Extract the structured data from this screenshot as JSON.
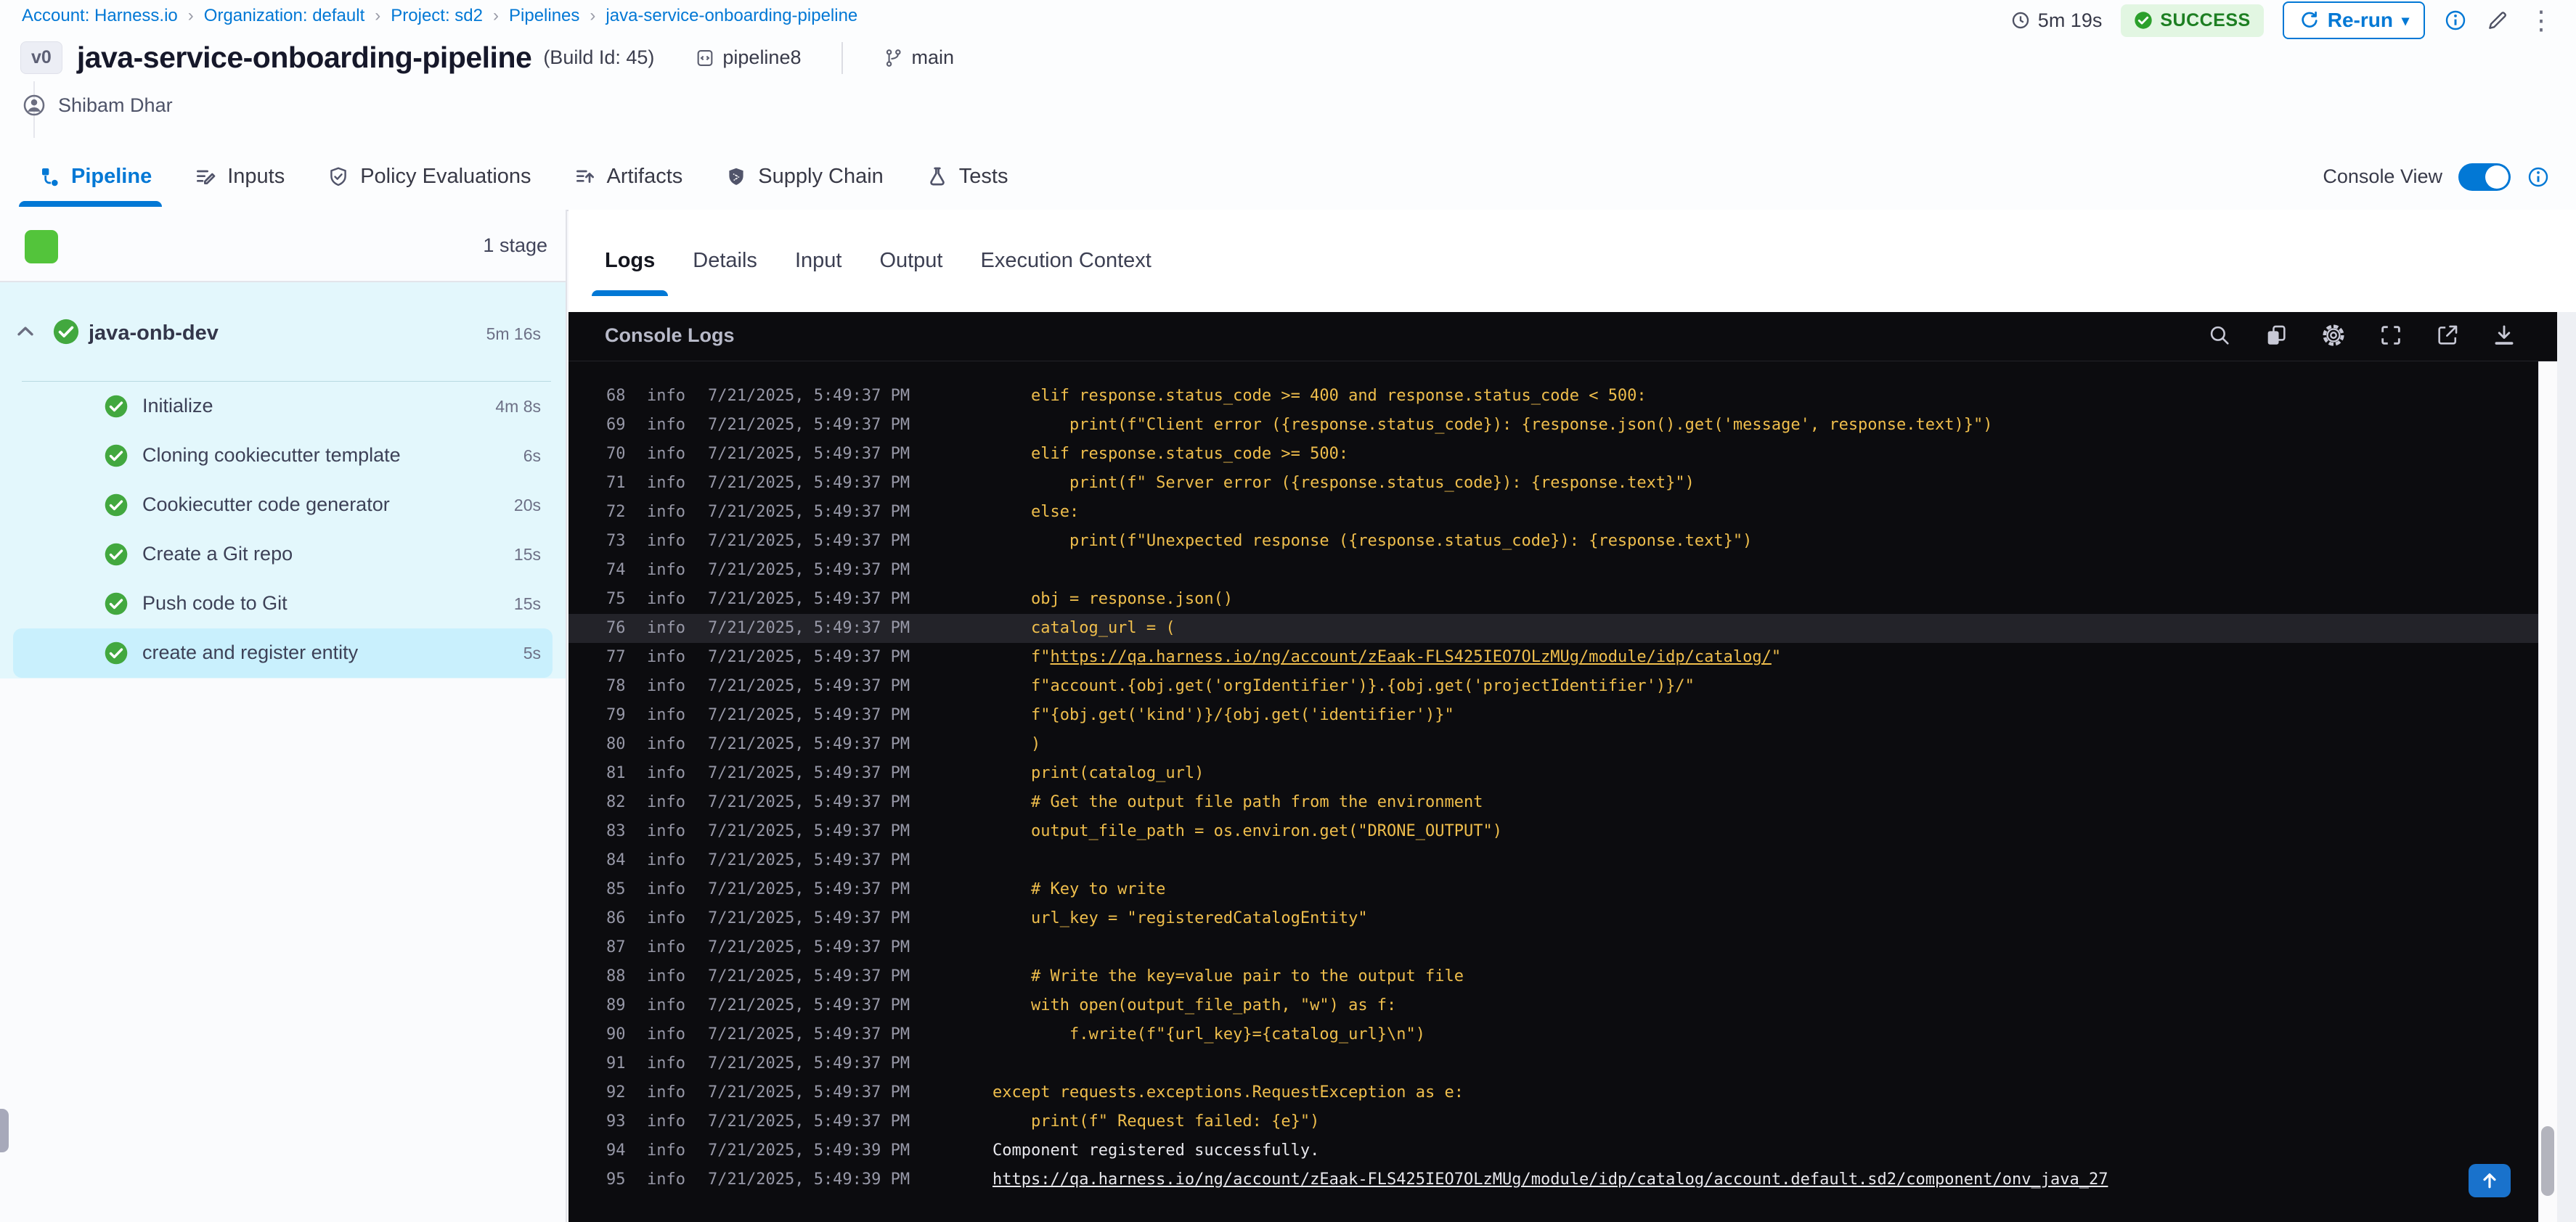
{
  "colors": {
    "accent": "#0278D5",
    "success_text": "#1D7F22",
    "success_badge_bg": "#E2F6E2",
    "check_green": "#42A83F",
    "stage_square_green": "#53C43B",
    "sidebar_bg": "#E3F7FC",
    "step_selected_bg": "#C9F0FD",
    "console_bg": "#0C0C0F",
    "log_yellow": "#EFBE4C",
    "log_white": "#E8E8ED",
    "log_meta_gray": "#9798A7"
  },
  "breadcrumb": {
    "items": [
      "Account: Harness.io",
      "Organization: default",
      "Project: sd2",
      "Pipelines",
      "java-service-onboarding-pipeline"
    ]
  },
  "header": {
    "version_tag": "v0",
    "title": "java-service-onboarding-pipeline",
    "build_id": "(Build Id: 45)",
    "pipeline_ref": "pipeline8",
    "branch": "main",
    "user": "Shibam Dhar",
    "duration": "5m 19s",
    "status": "SUCCESS",
    "rerun_label": "Re-run",
    "rerun_caret": "▾",
    "kebab": "⋮"
  },
  "tabbar": {
    "tabs": [
      {
        "label": "Pipeline",
        "icon": "pipeline",
        "active": true
      },
      {
        "label": "Inputs",
        "icon": "inputs",
        "active": false
      },
      {
        "label": "Policy Evaluations",
        "icon": "policy",
        "active": false
      },
      {
        "label": "Artifacts",
        "icon": "artifacts",
        "active": false
      },
      {
        "label": "Supply Chain",
        "icon": "supplychain",
        "active": false
      },
      {
        "label": "Tests",
        "icon": "tests",
        "active": false
      }
    ],
    "console_view_label": "Console View"
  },
  "sidebar": {
    "stage_count": "1 stage",
    "stage": {
      "name": "java-onb-dev",
      "duration": "5m 16s"
    },
    "steps": [
      {
        "label": "Initialize",
        "duration": "4m 8s",
        "selected": false
      },
      {
        "label": "Cloning cookiecutter template",
        "duration": "6s",
        "selected": false
      },
      {
        "label": "Cookiecutter code generator",
        "duration": "20s",
        "selected": false
      },
      {
        "label": "Create a Git repo",
        "duration": "15s",
        "selected": false
      },
      {
        "label": "Push code to Git",
        "duration": "15s",
        "selected": false
      },
      {
        "label": "create and register entity",
        "duration": "5s",
        "selected": true
      }
    ]
  },
  "main": {
    "log_tabs": [
      "Logs",
      "Details",
      "Input",
      "Output",
      "Execution Context"
    ]
  },
  "console": {
    "title": "Console Logs",
    "lines": [
      {
        "n": "68",
        "lvl": "info",
        "ts": "7/21/2025, 5:49:37 PM",
        "c": "y",
        "text": "    elif response.status_code >= 400 and response.status_code < 500:"
      },
      {
        "n": "69",
        "lvl": "info",
        "ts": "7/21/2025, 5:49:37 PM",
        "c": "y",
        "text": "        print(f\"Client error ({response.status_code}): {response.json().get('message', response.text)}\")"
      },
      {
        "n": "70",
        "lvl": "info",
        "ts": "7/21/2025, 5:49:37 PM",
        "c": "y",
        "text": "    elif response.status_code >= 500:"
      },
      {
        "n": "71",
        "lvl": "info",
        "ts": "7/21/2025, 5:49:37 PM",
        "c": "y",
        "text": "        print(f\" Server error ({response.status_code}): {response.text}\")"
      },
      {
        "n": "72",
        "lvl": "info",
        "ts": "7/21/2025, 5:49:37 PM",
        "c": "y",
        "text": "    else:"
      },
      {
        "n": "73",
        "lvl": "info",
        "ts": "7/21/2025, 5:49:37 PM",
        "c": "y",
        "text": "        print(f\"Unexpected response ({response.status_code}): {response.text}\")"
      },
      {
        "n": "74",
        "lvl": "info",
        "ts": "7/21/2025, 5:49:37 PM",
        "c": "y",
        "text": ""
      },
      {
        "n": "75",
        "lvl": "info",
        "ts": "7/21/2025, 5:49:37 PM",
        "c": "y",
        "text": "    obj = response.json()"
      },
      {
        "n": "76",
        "lvl": "info",
        "ts": "7/21/2025, 5:49:37 PM",
        "c": "y",
        "hl": true,
        "text": "    catalog_url = ("
      },
      {
        "n": "77",
        "lvl": "info",
        "ts": "7/21/2025, 5:49:37 PM",
        "c": "y",
        "seg": [
          {
            "t": "    f\""
          },
          {
            "t": "https://qa.harness.io/ng/account/zEaak-FLS425IEO7OLzMUg/module/idp/catalog/",
            "link": true
          },
          {
            "t": "\""
          }
        ]
      },
      {
        "n": "78",
        "lvl": "info",
        "ts": "7/21/2025, 5:49:37 PM",
        "c": "y",
        "text": "    f\"account.{obj.get('orgIdentifier')}.{obj.get('projectIdentifier')}/\""
      },
      {
        "n": "79",
        "lvl": "info",
        "ts": "7/21/2025, 5:49:37 PM",
        "c": "y",
        "text": "    f\"{obj.get('kind')}/{obj.get('identifier')}\""
      },
      {
        "n": "80",
        "lvl": "info",
        "ts": "7/21/2025, 5:49:37 PM",
        "c": "y",
        "text": "    )"
      },
      {
        "n": "81",
        "lvl": "info",
        "ts": "7/21/2025, 5:49:37 PM",
        "c": "y",
        "text": "    print(catalog_url)"
      },
      {
        "n": "82",
        "lvl": "info",
        "ts": "7/21/2025, 5:49:37 PM",
        "c": "y",
        "text": "    # Get the output file path from the environment"
      },
      {
        "n": "83",
        "lvl": "info",
        "ts": "7/21/2025, 5:49:37 PM",
        "c": "y",
        "text": "    output_file_path = os.environ.get(\"DRONE_OUTPUT\")"
      },
      {
        "n": "84",
        "lvl": "info",
        "ts": "7/21/2025, 5:49:37 PM",
        "c": "y",
        "text": ""
      },
      {
        "n": "85",
        "lvl": "info",
        "ts": "7/21/2025, 5:49:37 PM",
        "c": "y",
        "text": "    # Key to write"
      },
      {
        "n": "86",
        "lvl": "info",
        "ts": "7/21/2025, 5:49:37 PM",
        "c": "y",
        "text": "    url_key = \"registeredCatalogEntity\""
      },
      {
        "n": "87",
        "lvl": "info",
        "ts": "7/21/2025, 5:49:37 PM",
        "c": "y",
        "text": ""
      },
      {
        "n": "88",
        "lvl": "info",
        "ts": "7/21/2025, 5:49:37 PM",
        "c": "y",
        "text": "    # Write the key=value pair to the output file"
      },
      {
        "n": "89",
        "lvl": "info",
        "ts": "7/21/2025, 5:49:37 PM",
        "c": "y",
        "text": "    with open(output_file_path, \"w\") as f:"
      },
      {
        "n": "90",
        "lvl": "info",
        "ts": "7/21/2025, 5:49:37 PM",
        "c": "y",
        "text": "        f.write(f\"{url_key}={catalog_url}\\n\")"
      },
      {
        "n": "91",
        "lvl": "info",
        "ts": "7/21/2025, 5:49:37 PM",
        "c": "y",
        "text": ""
      },
      {
        "n": "92",
        "lvl": "info",
        "ts": "7/21/2025, 5:49:37 PM",
        "c": "y",
        "text": "except requests.exceptions.RequestException as e:"
      },
      {
        "n": "93",
        "lvl": "info",
        "ts": "7/21/2025, 5:49:37 PM",
        "c": "y",
        "text": "    print(f\" Request failed: {e}\")"
      },
      {
        "n": "94",
        "lvl": "info",
        "ts": "7/21/2025, 5:49:39 PM",
        "c": "w",
        "text": "Component registered successfully."
      },
      {
        "n": "95",
        "lvl": "info",
        "ts": "7/21/2025, 5:49:39 PM",
        "c": "w",
        "seg": [
          {
            "t": "https://qa.harness.io/ng/account/zEaak-FLS425IEO7OLzMUg/module/idp/catalog/account.default.sd2/component/onv_java_27",
            "link": true
          }
        ]
      }
    ]
  }
}
